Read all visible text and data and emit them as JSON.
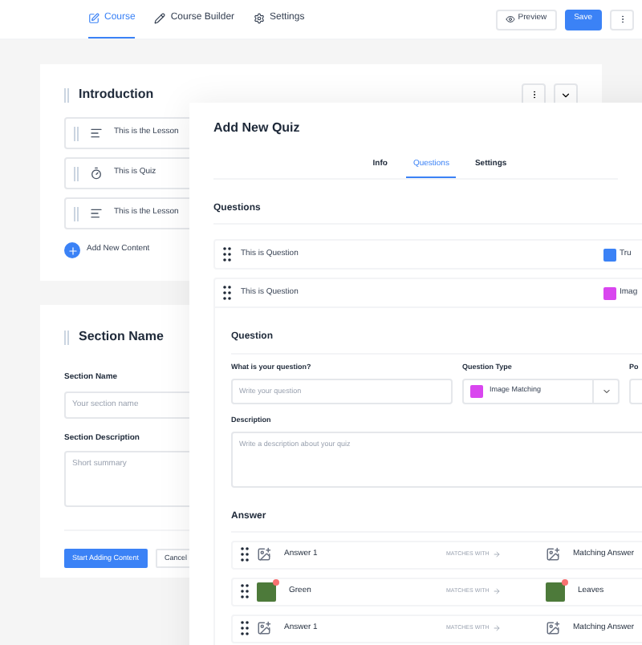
{
  "header": {
    "tabs": [
      {
        "label": "Course",
        "selected": true
      },
      {
        "label": "Course Builder",
        "selected": false
      },
      {
        "label": "Settings",
        "selected": false
      }
    ],
    "preview": "Preview",
    "save": "Save"
  },
  "section_card": {
    "title": "Introduction",
    "items": [
      {
        "label": "This is the Lesson",
        "kind": "lesson"
      },
      {
        "label": "This is Quiz",
        "kind": "quiz"
      },
      {
        "label": "This is the Lesson",
        "kind": "lesson"
      }
    ],
    "add": "Add New Content"
  },
  "new_section": {
    "title": "Section Name",
    "name_label": "Section Name",
    "name_placeholder": "Your section name",
    "desc_label": "Section Description",
    "desc_placeholder": "Short summary",
    "submit": "Start Adding Content",
    "cancel": "Cancel"
  },
  "modal": {
    "title": "Add New Quiz",
    "tabs": [
      {
        "label": "Info",
        "selected": false
      },
      {
        "label": "Questions",
        "selected": true
      },
      {
        "label": "Settings",
        "selected": false
      }
    ],
    "questions_heading": "Questions",
    "questions": [
      {
        "label": "This is Question",
        "type": "Tru",
        "color": "#3b82f6",
        "expanded": false
      },
      {
        "label": "This is Question",
        "type": "Imag",
        "color": "#d946ef",
        "expanded": true
      }
    ],
    "form": {
      "heading": "Question",
      "question_label": "What is your question?",
      "question_placeholder": "Write your question",
      "type_label": "Question Type",
      "type_value": "Image Matching",
      "points_label": "Po",
      "desc_label": "Description",
      "desc_placeholder": "Write a description about your quiz"
    },
    "answer_heading": "Answer",
    "answers": [
      {
        "left": {
          "text": "Answer 1",
          "kind": "icon"
        },
        "matches": "MATCHES WITH",
        "right": {
          "text": "Matching Answer",
          "kind": "icon"
        }
      },
      {
        "left": {
          "text": "Green",
          "kind": "photo"
        },
        "matches": "MATCHES WITH",
        "right": {
          "text": "Leaves",
          "kind": "photo"
        }
      },
      {
        "left": {
          "text": "Answer 1",
          "kind": "icon"
        },
        "matches": "MATCHES WITH",
        "right": {
          "text": "Matching Answer",
          "kind": "icon"
        }
      }
    ]
  }
}
